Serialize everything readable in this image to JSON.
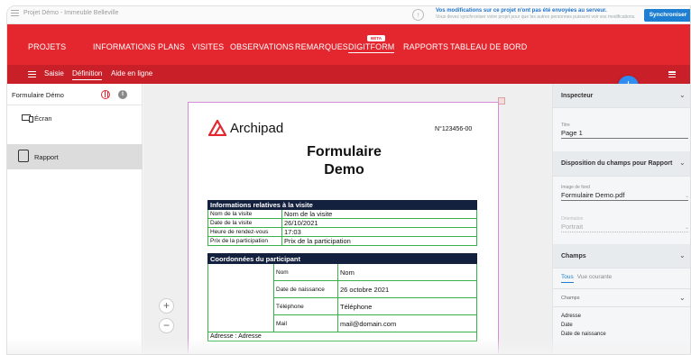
{
  "topbar": {
    "project": "Projet Démo - Immeuble Belleville",
    "message_title": "Vos modifications sur ce projet n'ont pas été envoyées au serveur.",
    "message_sub": "Vous devez synchroniser votre projet pour que les autres personnes puissent voir vos modifications.",
    "sync_label": "Synchroniser"
  },
  "nav": {
    "projets": "PROJETS",
    "informations": "INFORMATIONS",
    "plans": "PLANS",
    "visites": "VISITES",
    "observations": "OBSERVATIONS",
    "remarques": "REMARQUES",
    "digitform": "DIGITFORM",
    "beta": "BETA",
    "rapports": "RAPPORTS",
    "tableau": "TABLEAU DE BORD"
  },
  "subnav": {
    "saisie": "Saisie",
    "definition": "Définition",
    "aide": "Aide en ligne"
  },
  "fab_label": "+",
  "left": {
    "title": "Formulaire Démo",
    "info": "i",
    "items": [
      {
        "label": "Écran"
      },
      {
        "label": "Rapport"
      }
    ]
  },
  "zoom": {
    "plus": "+",
    "minus": "−"
  },
  "document": {
    "logo": "Archipad",
    "number": "N°123456-00",
    "title_line1": "Formulaire",
    "title_line2": "Demo",
    "visit_header": "Informations relatives à la visite",
    "visit_rows": [
      {
        "label": "Nom de la visite",
        "value": "Nom de la visite"
      },
      {
        "label": "Date de la visite",
        "value": "26/10/2021"
      },
      {
        "label": "Heure de rendez-vous",
        "value": "17:03"
      },
      {
        "label": "Prix de la participation",
        "value": "Prix de la participation"
      }
    ],
    "part_header": "Coordonnées du participant",
    "part_rows": [
      {
        "label": "Nom",
        "value": "Nom"
      },
      {
        "label": "Date de naissance",
        "value": "26 octobre 2021"
      },
      {
        "label": "Téléphone",
        "value": "Téléphone"
      },
      {
        "label": "Mail",
        "value": "mail@domain.com"
      }
    ],
    "address_label": "Adresse :",
    "address_value": "Adresse"
  },
  "right": {
    "inspecteur": "Inspecteur",
    "titre_label": "Titre",
    "titre_value": "Page 1",
    "disposition": "Disposition du champs pour Rapport",
    "image_label": "Image de fond",
    "image_value": "Formulaire Demo.pdf",
    "orientation_label": "Orientation",
    "orientation_value": "Portrait",
    "champs": "Champs",
    "tab_tous": "Tous",
    "tab_vue": "Vue courante",
    "champs_sub": "Champs",
    "fields": [
      "Adresse",
      "Date",
      "Date de naissance"
    ]
  }
}
